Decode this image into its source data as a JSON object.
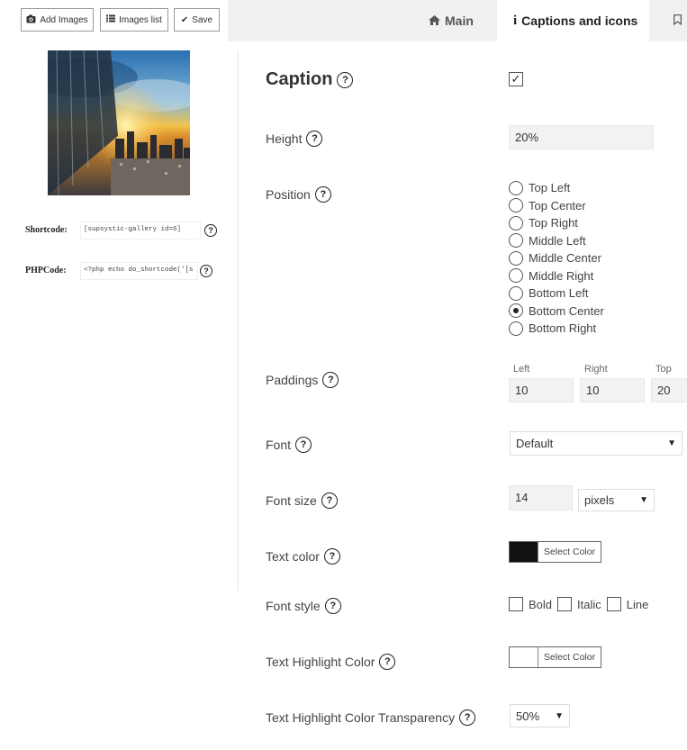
{
  "toolbar": {
    "add_images": "Add Images",
    "images_list": "Images list",
    "save": "Save"
  },
  "tabs": {
    "main": "Main",
    "captions": "Captions and icons"
  },
  "left": {
    "shortcode_label": "Shortcode:",
    "shortcode_value": "[supsystic-gallery id=6]",
    "phpcode_label": "PHPCode:",
    "phpcode_value": "<?php echo do_shortcode('[s"
  },
  "form": {
    "caption_label": "Caption",
    "caption_checked": "✓",
    "height_label": "Height",
    "height_value": "20%",
    "position_label": "Position",
    "positions": [
      "Top Left",
      "Top Center",
      "Top Right",
      "Middle Left",
      "Middle Center",
      "Middle Right",
      "Bottom Left",
      "Bottom Center",
      "Bottom Right"
    ],
    "position_selected": "Bottom Center",
    "paddings_label": "Paddings",
    "pad_left_label": "Left",
    "pad_left_value": "10",
    "pad_right_label": "Right",
    "pad_right_value": "10",
    "pad_top_label": "Top",
    "pad_top_value": "20",
    "font_label": "Font",
    "font_value": "Default",
    "font_size_label": "Font size",
    "font_size_value": "14",
    "font_unit": "pixels",
    "text_color_label": "Text color",
    "text_color_swatch": "#111111",
    "select_color": "Select Color",
    "font_style_label": "Font style",
    "bold": "Bold",
    "italic": "Italic",
    "line": "Line",
    "highlight_label": "Text Highlight Color",
    "highlight_swatch": "#ffffff",
    "transparency_label": "Text Highlight Color Transparency",
    "transparency_value": "50%"
  }
}
